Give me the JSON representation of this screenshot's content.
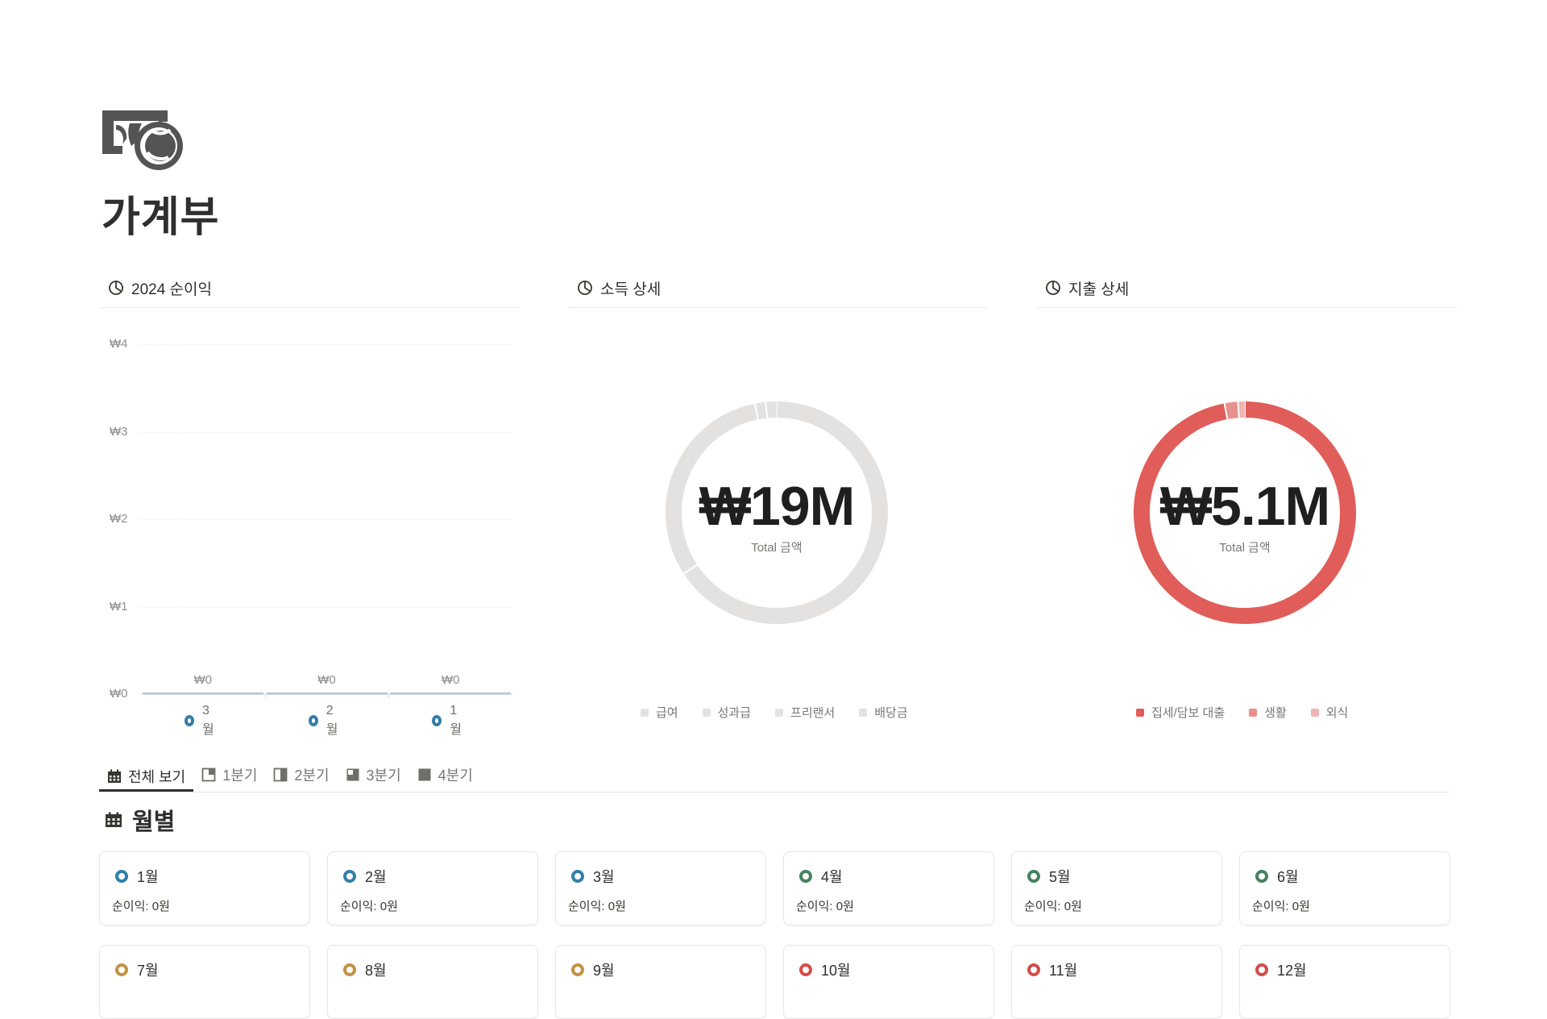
{
  "page": {
    "title": "가계부",
    "icon": "money-hand-icon"
  },
  "charts": {
    "net_income": {
      "title": "2024 순이익",
      "icon": "chart-icon"
    },
    "income_detail": {
      "title": "소득 상세",
      "icon": "chart-icon",
      "total": "₩19M",
      "total_label": "Total 금액"
    },
    "expense_detail": {
      "title": "지출 상세",
      "icon": "chart-icon",
      "total": "₩5.1M",
      "total_label": "Total 금액"
    }
  },
  "chart_data": [
    {
      "type": "bar",
      "title": "2024 순이익",
      "categories": [
        "3월",
        "2월",
        "1월"
      ],
      "values": [
        0,
        0,
        0
      ],
      "value_labels": [
        "₩0",
        "₩0",
        "₩0"
      ],
      "y_ticks": [
        "₩0",
        "₩1",
        "₩2",
        "₩3",
        "₩4"
      ],
      "ylim": [
        0,
        4
      ],
      "grid": true,
      "category_color": "#337ea9"
    },
    {
      "type": "pie",
      "title": "소득 상세",
      "center_text": "₩19M",
      "center_subtext": "Total 금액",
      "labels": [
        "급여",
        "성과급",
        "프리랜서",
        "배당금"
      ],
      "values": [
        12.5,
        5.9,
        0.3,
        0.3
      ],
      "colors": [
        "#e3e2e0",
        "#e3e2e0",
        "#e3e2e0",
        "#e3e2e0"
      ],
      "legend_position": "bottom"
    },
    {
      "type": "pie",
      "title": "지출 상세",
      "center_text": "₩5.1M",
      "center_subtext": "Total 금액",
      "labels": [
        "집세/담보 대출",
        "생활",
        "외식"
      ],
      "values": [
        4.95,
        0.1,
        0.05
      ],
      "colors": [
        "#e05d5a",
        "#e7908d",
        "#f0b4b2"
      ],
      "legend_position": "bottom"
    }
  ],
  "tabs": [
    {
      "label": "전체 보기",
      "icon": "calendar-icon",
      "active": true
    },
    {
      "label": "1분기",
      "icon": "quarter1-icon",
      "active": false
    },
    {
      "label": "2분기",
      "icon": "quarter2-icon",
      "active": false
    },
    {
      "label": "3분기",
      "icon": "quarter3-icon",
      "active": false
    },
    {
      "label": "4분기",
      "icon": "quarter4-icon",
      "active": false
    }
  ],
  "section": {
    "title": "월별",
    "icon": "calendar-icon"
  },
  "months": [
    {
      "name": "1월",
      "net": "순이익: 0원",
      "color": "#337ea9"
    },
    {
      "name": "2월",
      "net": "순이익: 0원",
      "color": "#337ea9"
    },
    {
      "name": "3월",
      "net": "순이익: 0원",
      "color": "#337ea9"
    },
    {
      "name": "4월",
      "net": "순이익: 0원",
      "color": "#448361"
    },
    {
      "name": "5월",
      "net": "순이익: 0원",
      "color": "#448361"
    },
    {
      "name": "6월",
      "net": "순이익: 0원",
      "color": "#448361"
    },
    {
      "name": "7월",
      "net": "",
      "color": "#c29343"
    },
    {
      "name": "8월",
      "net": "",
      "color": "#c29343"
    },
    {
      "name": "9월",
      "net": "",
      "color": "#c29343"
    },
    {
      "name": "10월",
      "net": "",
      "color": "#d44c47"
    },
    {
      "name": "11월",
      "net": "",
      "color": "#d44c47"
    },
    {
      "name": "12월",
      "net": "",
      "color": "#d44c47"
    }
  ]
}
